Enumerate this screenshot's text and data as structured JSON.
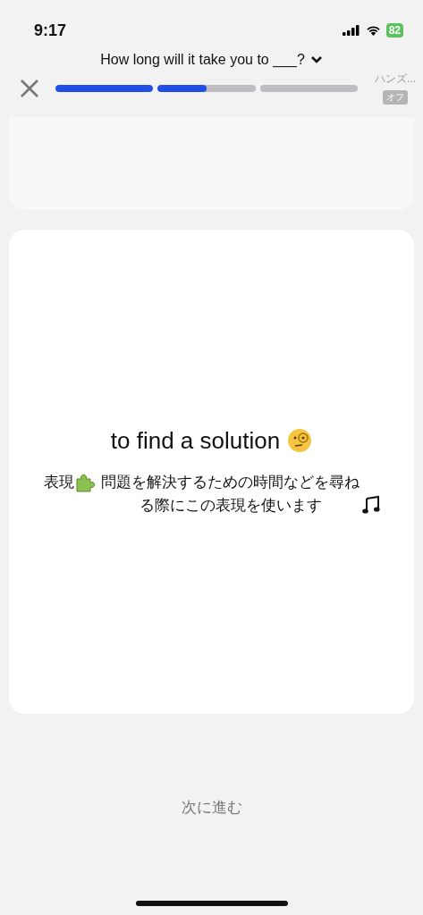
{
  "status_bar": {
    "time": "9:17",
    "battery": "82"
  },
  "header": {
    "question": "How long will it take you to ___?",
    "progress": [
      {
        "kind": "active",
        "level": 1
      },
      {
        "kind": "active",
        "level": 0.5
      },
      {
        "kind": "pending"
      }
    ],
    "handsfree": {
      "label": "ハンズ...",
      "value": "オフ"
    }
  },
  "card": {
    "phrase": "to find a solution",
    "note_lead": "表現",
    "note": "問題を解決するための時間などを尋ねる際にこの表現を使います"
  },
  "next_button": "次に進む"
}
